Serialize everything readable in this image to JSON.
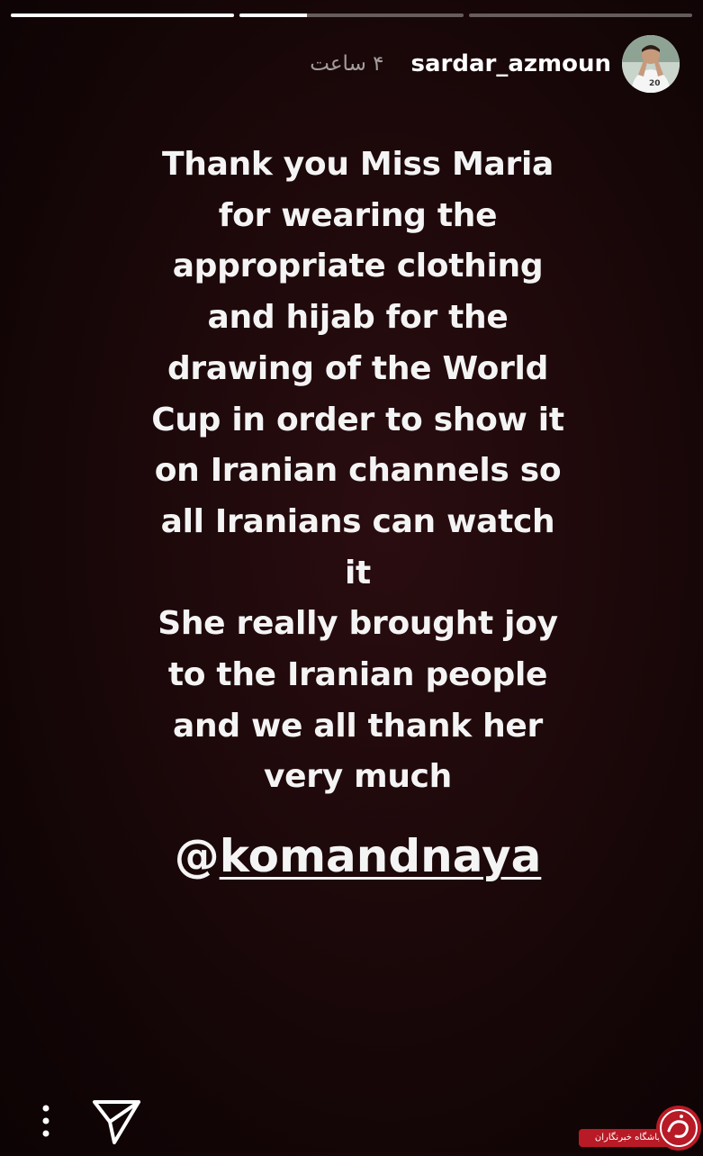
{
  "story": {
    "progress": [
      1,
      0.3,
      0
    ]
  },
  "header": {
    "username": "sardar_azmoun",
    "time": "۴ ساعت",
    "avatar_icon": "profile-avatar-icon"
  },
  "post": {
    "body": "Thank you Miss Maria\nfor wearing the\nappropriate clothing\nand hijab for the\ndrawing of the World\nCup in order to show it\non Iranian channels so\nall Iranians can watch\nit\nShe really brought joy\nto the Iranian people\nand we all thank her\nvery much",
    "mention_at": "@",
    "mention_handle": "komandnaya"
  },
  "footer": {
    "more_icon": "more-options-icon",
    "share_icon": "send-direct-icon"
  },
  "watermark": {
    "label": "باشگاه خبرنگاران",
    "logo_icon": "watermark-logo-icon",
    "accent": "#b81a26"
  }
}
